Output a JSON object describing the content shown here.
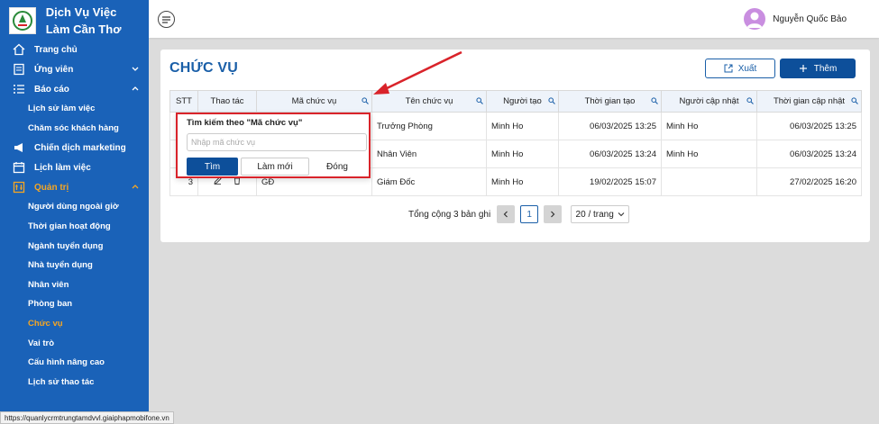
{
  "brand": {
    "title": "Dịch Vụ Việc Làm Cần Thơ"
  },
  "sidebar": {
    "items": [
      {
        "label": "Trang chủ",
        "icon": "home-icon"
      },
      {
        "label": "Ứng viên",
        "icon": "candidate-icon",
        "chevron": "down"
      },
      {
        "label": "Báo cáo",
        "icon": "list-icon",
        "chevron": "up"
      },
      {
        "label": "Lịch sử làm việc",
        "sub": true
      },
      {
        "label": "Chăm sóc khách hàng",
        "sub": true
      },
      {
        "label": "Chiến dịch marketing",
        "icon": "megaphone-icon"
      },
      {
        "label": "Lịch làm việc",
        "icon": "calendar-icon"
      },
      {
        "label": "Quản trị",
        "icon": "admin-icon",
        "chevron": "up",
        "active": true
      },
      {
        "label": "Người dùng ngoài giờ",
        "sub": true
      },
      {
        "label": "Thời gian hoạt động",
        "sub": true
      },
      {
        "label": "Ngành tuyển dụng",
        "sub": true
      },
      {
        "label": "Nhà tuyển dụng",
        "sub": true
      },
      {
        "label": "Nhân viên",
        "sub": true
      },
      {
        "label": "Phòng ban",
        "sub": true
      },
      {
        "label": "Chức vụ",
        "sub": true,
        "active": true
      },
      {
        "label": "Vai trò",
        "sub": true
      },
      {
        "label": "Cấu hình nâng cao",
        "sub": true
      },
      {
        "label": "Lịch sử thao tác",
        "sub": true
      }
    ]
  },
  "header": {
    "user_name": "Nguyễn Quốc Bảo"
  },
  "main": {
    "title": "CHỨC VỤ",
    "export_label": "Xuất",
    "add_label": "Thêm",
    "columns": [
      "STT",
      "Thao tác",
      "Mã chức vụ",
      "Tên chức vụ",
      "Người tạo",
      "Thời gian tạo",
      "Người cập nhật",
      "Thời gian cập nhật"
    ],
    "rows": [
      {
        "stt": "",
        "code": "",
        "name": "Trưởng Phòng",
        "creator": "Minh Ho",
        "created": "06/03/2025 13:25",
        "updater": "Minh Ho",
        "updated": "06/03/2025 13:25"
      },
      {
        "stt": "",
        "code": "",
        "name": "Nhân Viên",
        "creator": "Minh Ho",
        "created": "06/03/2025 13:24",
        "updater": "Minh Ho",
        "updated": "06/03/2025 13:24"
      },
      {
        "stt": "3",
        "code": "GĐ",
        "name": "Giám Đốc",
        "creator": "Minh Ho",
        "created": "19/02/2025 15:07",
        "updater": "",
        "updated": "27/02/2025 16:20"
      }
    ],
    "pagination": {
      "total_label": "Tổng cộng 3 bản ghi",
      "current": "1",
      "page_size": "20 / trang"
    }
  },
  "popup": {
    "title": "Tìm kiếm theo \"Mã chức vụ\"",
    "placeholder": "Nhập mã chức vụ",
    "search_label": "Tìm",
    "reset_label": "Làm mới",
    "close_label": "Đóng"
  },
  "status_url": "https://quanlycrmtrungtamdvvl.giaiphapmobifone.vn",
  "colors": {
    "sidebar": "#1a62b8",
    "accent": "#0d4f9a",
    "active": "#f5a623",
    "annotation": "#d9232a"
  }
}
